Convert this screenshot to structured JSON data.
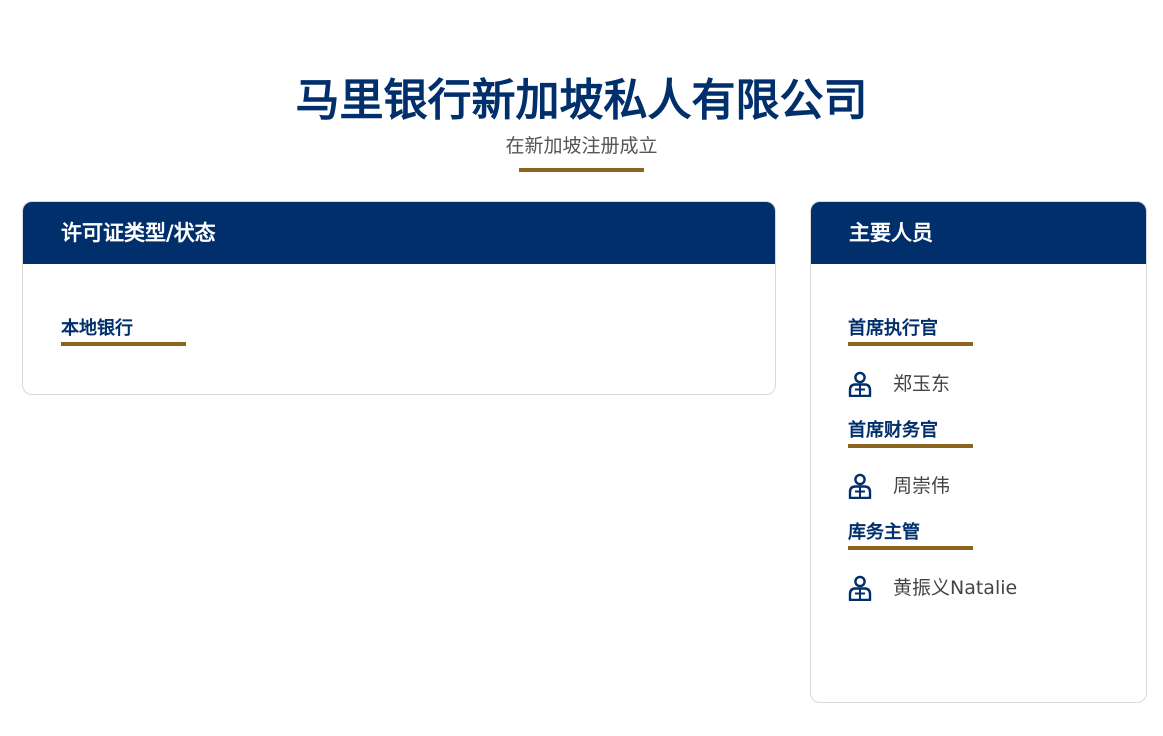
{
  "hero": {
    "title": "马里银行新加坡私人有限公司",
    "subtitle": "在新加坡注册成立"
  },
  "license": {
    "heading": "许可证类型/状态",
    "type": "本地银行"
  },
  "people": {
    "heading": "主要人员",
    "roles": [
      {
        "title": "首席执行官",
        "name": "郑玉东",
        "icon": "person-icon"
      },
      {
        "title": "首席财务官",
        "name": "周崇伟",
        "icon": "person-icon"
      },
      {
        "title": "库务主管",
        "name": "黄振义Natalie",
        "icon": "person-icon"
      }
    ]
  },
  "colors": {
    "navy": "#002f6c",
    "gold": "#8b6420",
    "text": "#444444"
  }
}
